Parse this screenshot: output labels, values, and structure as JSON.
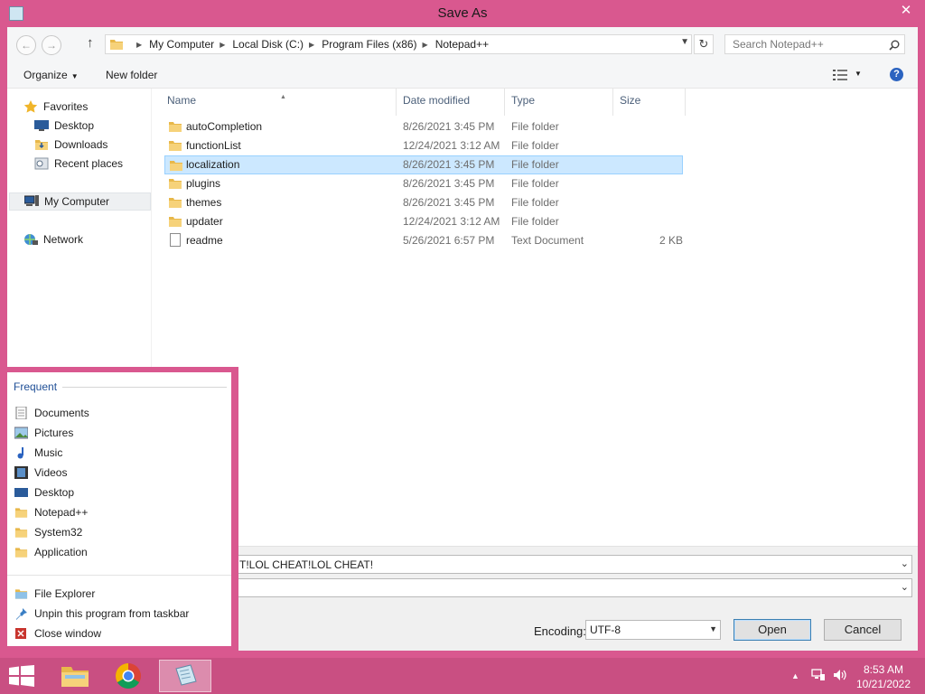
{
  "window": {
    "title": "Save As",
    "close_glyph": "✕",
    "colors": {
      "frame": "#d9588f",
      "taskbar": "#c94f82",
      "selection": "#cce8ff",
      "link": "#1f4f96"
    }
  },
  "address": {
    "back_glyph": "←",
    "forward_glyph": "→",
    "up_glyph": "↑",
    "crumbs": [
      "My Computer",
      "Local Disk (C:)",
      "Program Files (x86)",
      "Notepad++"
    ],
    "refresh_glyph": "↻",
    "search_placeholder": "Search Notepad++"
  },
  "toolbar": {
    "organize_label": "Organize",
    "new_folder_label": "New folder",
    "help_glyph": "?"
  },
  "nav_pane": {
    "favorites": "Favorites",
    "desktop": "Desktop",
    "downloads": "Downloads",
    "recent_places": "Recent places",
    "my_computer": "My Computer",
    "network": "Network"
  },
  "columns": {
    "name": "Name",
    "date_modified": "Date modified",
    "type": "Type",
    "size": "Size"
  },
  "files": [
    {
      "name": "autoCompletion",
      "date": "8/26/2021 3:45 PM",
      "type": "File folder",
      "size": "",
      "icon": "folder-icon"
    },
    {
      "name": "functionList",
      "date": "12/24/2021 3:12 AM",
      "type": "File folder",
      "size": "",
      "icon": "folder-icon"
    },
    {
      "name": "localization",
      "date": "8/26/2021 3:45 PM",
      "type": "File folder",
      "size": "",
      "icon": "folder-icon",
      "selected": true
    },
    {
      "name": "plugins",
      "date": "8/26/2021 3:45 PM",
      "type": "File folder",
      "size": "",
      "icon": "folder-icon"
    },
    {
      "name": "themes",
      "date": "8/26/2021 3:45 PM",
      "type": "File folder",
      "size": "",
      "icon": "folder-icon"
    },
    {
      "name": "updater",
      "date": "12/24/2021 3:12 AM",
      "type": "File folder",
      "size": "",
      "icon": "folder-icon"
    },
    {
      "name": "readme",
      "date": "5/26/2021 6:57 PM",
      "type": "Text Document",
      "size": "2 KB",
      "icon": "text-document-icon"
    }
  ],
  "save": {
    "file_name_value": "T!LOL CHEAT!LOL CHEAT!",
    "save_type_value": "",
    "encoding_label": "Encoding:",
    "encoding_value": "UTF-8",
    "open_label": "Open",
    "cancel_label": "Cancel"
  },
  "jumplist": {
    "frequent_header": "Frequent",
    "frequent": [
      "Documents",
      "Pictures",
      "Music",
      "Videos",
      "Desktop",
      "Notepad++",
      "System32",
      "Application"
    ],
    "tasks": [
      "File Explorer",
      "Unpin this program from taskbar",
      "Close window"
    ]
  },
  "taskbar": {
    "time": "8:53 AM",
    "date": "10/21/2022",
    "tray_up_glyph": "▲"
  }
}
